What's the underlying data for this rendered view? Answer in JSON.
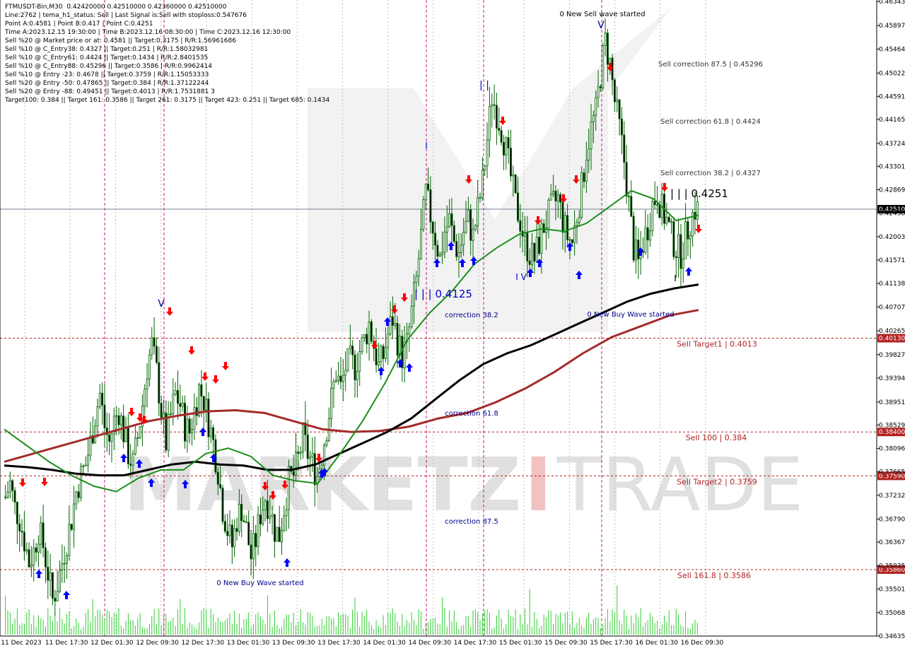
{
  "header": {
    "lines": [
      "FTMUSDT-Bin,M30  0.42420000 0.42510000 0.42360000 0.42510000",
      "Line:2762 | tema_h1_status: Sell | Last Signal is:Sell with stoploss:0.547676",
      "Point A:0.4581 | Point B:0.417 | Point C:0.4251",
      "Time A:2023.12.15 19:30:00 | Time B:2023.12.16 08:30:00 | Time C:2023.12.16 12:30:00",
      "Sell %20 @ Market price or at: 0.4581 || Target:0.3175 | R/R:1.56961686",
      "Sell %10 @ C_Entry38: 0.4327 || Target:0.251 | R/R:1.58032981",
      "Sell %10 @ C_Entry61: 0.4424 || Target:0.1434 | R/R:2.8401535",
      "Sell %10 @ C_Entry88: 0.45296 || Target:0.3586 | R/R:0.9962414",
      "Sell %10 @ Entry -23: 0.4678 || Target:0.3759 | R/R:1.15053333",
      "Sell %20 @ Entry -50: 0.47865 || Target:0.384 | R/R:1.37122244",
      "Sell %20 @ Entry -88: 0.49451 || Target:0.4013 | R/R:1.7531881 3",
      "Target100: 0.384 || Target 161: 0.3586 || Target 261: 0.3175 || Target 423: 0.251 || Target 685: 0.1434"
    ]
  },
  "watermark": {
    "left": "MARKETZ",
    "mid": "I",
    "right": "TRADE"
  },
  "colors": {
    "bull": "#006400",
    "bear": "#006400",
    "ma_green": "#1a8f1a",
    "ma_black": "#000000",
    "ma_brown": "#a52a2a",
    "level": "#b22222",
    "arrow_up": "#0000ff",
    "arrow_down": "#ff0000",
    "current_line": "#708090",
    "grid": "#c0c0c0",
    "vline_pink": "#c71585"
  },
  "chart_data": {
    "type": "candlestick",
    "symbol": "FTMUSDT-Bin",
    "timeframe": "M30",
    "ylim": [
      0.34635,
      0.46343
    ],
    "y_ticks": [
      "0.46343",
      "0.45897",
      "0.45464",
      "0.45022",
      "0.44591",
      "0.44165",
      "0.43724",
      "0.43301",
      "0.42869",
      "0.42438",
      "0.42003",
      "0.41571",
      "0.41138",
      "0.40707",
      "0.40265",
      "0.39827",
      "0.39394",
      "0.38951",
      "0.38529",
      "0.38096",
      "0.37665",
      "0.37232",
      "0.36790",
      "0.36367",
      "0.35935",
      "0.35501",
      "0.35068",
      "0.34635"
    ],
    "y_tick_values": [
      0.46343,
      0.45897,
      0.45464,
      0.45022,
      0.44591,
      0.44165,
      0.43724,
      0.43301,
      0.42869,
      0.42438,
      0.42003,
      0.41571,
      0.41138,
      0.40707,
      0.40265,
      0.39827,
      0.39394,
      0.38951,
      0.38529,
      0.38096,
      0.37665,
      0.37232,
      0.3679,
      0.36367,
      0.35935,
      0.35501,
      0.35068,
      0.34635
    ],
    "x_ticks": [
      "11 Dec 2023",
      "11 Dec 17:30",
      "12 Dec 01:30",
      "12 Dec 09:30",
      "12 Dec 17:30",
      "13 Dec 01:30",
      "13 Dec 09:30",
      "13 Dec 17:30",
      "14 Dec 01:30",
      "14 Dec 09:30",
      "14 Dec 17:30",
      "15 Dec 01:30",
      "15 Dec 09:30",
      "15 Dec 17:30",
      "16 Dec 01:30",
      "16 Dec 09:30"
    ],
    "current_price": 0.4251,
    "current_price_label": "0.42510",
    "price_path": [
      0.372,
      0.3745,
      0.37,
      0.368,
      0.364,
      0.36,
      0.362,
      0.366,
      0.363,
      0.358,
      0.353,
      0.356,
      0.36,
      0.364,
      0.368,
      0.373,
      0.376,
      0.378,
      0.382,
      0.387,
      0.391,
      0.385,
      0.382,
      0.386,
      0.388,
      0.384,
      0.38,
      0.378,
      0.383,
      0.389,
      0.396,
      0.4,
      0.395,
      0.388,
      0.382,
      0.387,
      0.391,
      0.389,
      0.385,
      0.384,
      0.388,
      0.392,
      0.39,
      0.386,
      0.382,
      0.377,
      0.37,
      0.366,
      0.363,
      0.368,
      0.37,
      0.366,
      0.361,
      0.364,
      0.369,
      0.372,
      0.37,
      0.366,
      0.365,
      0.37,
      0.375,
      0.376,
      0.379,
      0.383,
      0.38,
      0.378,
      0.376,
      0.38,
      0.385,
      0.39,
      0.395,
      0.392,
      0.396,
      0.397,
      0.396,
      0.399,
      0.401,
      0.404,
      0.4,
      0.396,
      0.398,
      0.402,
      0.405,
      0.401,
      0.398,
      0.4,
      0.406,
      0.412,
      0.42,
      0.428,
      0.424,
      0.42,
      0.416,
      0.421,
      0.423,
      0.419,
      0.417,
      0.421,
      0.423,
      0.42,
      0.425,
      0.43,
      0.438,
      0.446,
      0.443,
      0.44,
      0.436,
      0.431,
      0.426,
      0.423,
      0.419,
      0.417,
      0.416,
      0.419,
      0.422,
      0.424,
      0.426,
      0.427,
      0.423,
      0.42,
      0.419,
      0.424,
      0.429,
      0.436,
      0.44,
      0.443,
      0.45,
      0.456,
      0.452,
      0.445,
      0.44,
      0.434,
      0.426,
      0.418,
      0.415,
      0.419,
      0.422,
      0.426,
      0.428,
      0.425,
      0.423,
      0.42,
      0.418,
      0.417,
      0.42,
      0.423,
      0.4251
    ],
    "ma_green": [
      0.3845,
      0.3815,
      0.3785,
      0.376,
      0.374,
      0.373,
      0.3755,
      0.377,
      0.377,
      0.38,
      0.381,
      0.3795,
      0.376,
      0.375,
      0.3745,
      0.38,
      0.386,
      0.393,
      0.401,
      0.406,
      0.41,
      0.415,
      0.418,
      0.4205,
      0.4215,
      0.421,
      0.4225,
      0.4255,
      0.4285,
      0.427,
      0.423,
      0.424
    ],
    "ma_black": [
      0.3778,
      0.3775,
      0.377,
      0.3763,
      0.376,
      0.376,
      0.377,
      0.378,
      0.3785,
      0.378,
      0.3778,
      0.377,
      0.377,
      0.378,
      0.38,
      0.382,
      0.384,
      0.3865,
      0.39,
      0.3935,
      0.3965,
      0.3985,
      0.4,
      0.402,
      0.404,
      0.406,
      0.408,
      0.4095,
      0.4105,
      0.4112
    ],
    "ma_brown": [
      0.3785,
      0.38,
      0.3815,
      0.383,
      0.3845,
      0.386,
      0.387,
      0.3878,
      0.388,
      0.3875,
      0.386,
      0.3845,
      0.384,
      0.3842,
      0.385,
      0.3865,
      0.3875,
      0.3895,
      0.392,
      0.395,
      0.3985,
      0.4015,
      0.4035,
      0.4055,
      0.4065
    ],
    "levels": [
      {
        "label": "Sell Target1 | 0.4013",
        "value": 0.4013,
        "axis_label": "0.40130"
      },
      {
        "label": "Sell 100 | 0.384",
        "value": 0.384,
        "axis_label": "0.38400"
      },
      {
        "label": "Sell Target2 | 0.3759",
        "value": 0.3759,
        "axis_label": "0.37590"
      },
      {
        "label": "Sell 161.8 | 0.3586",
        "value": 0.3586,
        "axis_label": "0.35860"
      }
    ],
    "annotations": [
      {
        "text": "0 New Sell wave started"
      },
      {
        "text": "Sell correction 87.5 | 0.45296"
      },
      {
        "text": "Sell correction 61.8 | 0.4424"
      },
      {
        "text": "Sell correction 38.2 | 0.4327"
      },
      {
        "text": "| | | 0.4251"
      },
      {
        "text": "| | | 0.4125"
      },
      {
        "text": "correction 38.2"
      },
      {
        "text": "correction 61.8"
      },
      {
        "text": "correction 87.5"
      },
      {
        "text": "0 New Buy Wave started"
      },
      {
        "text": "0 New Buy Wave started"
      },
      {
        "text": "V"
      },
      {
        "text": "V"
      },
      {
        "text": "| |"
      },
      {
        "text": "I V"
      },
      {
        "text": "I"
      },
      {
        "text": "I"
      }
    ]
  }
}
